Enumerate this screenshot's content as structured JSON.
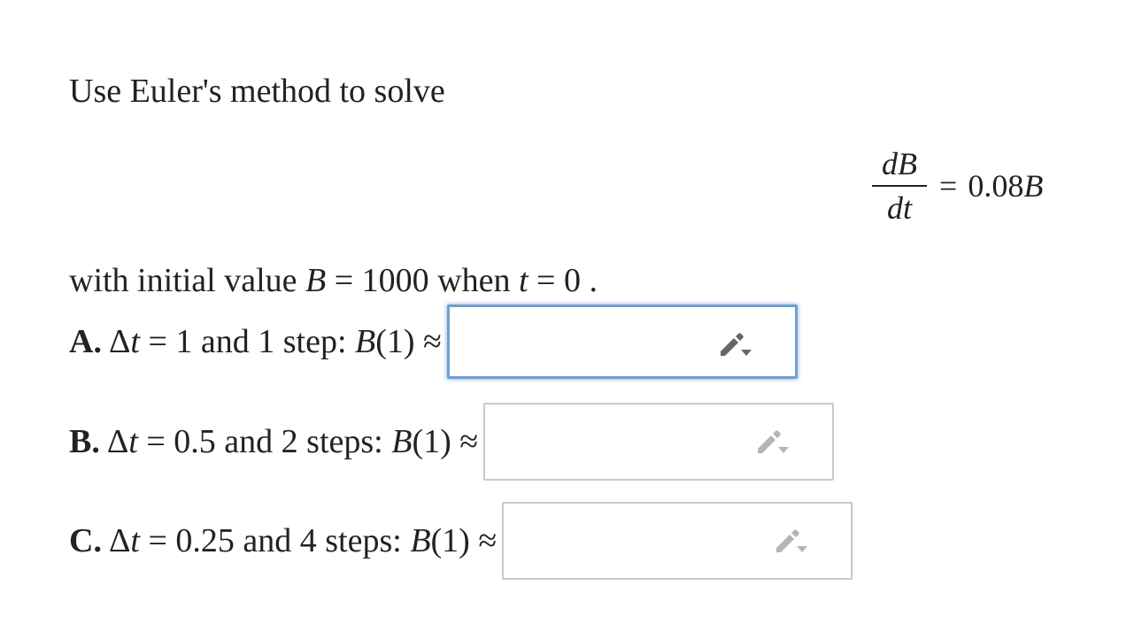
{
  "problem": {
    "intro": "Use Euler's method to solve",
    "equation": {
      "numerator": "dB",
      "denominator": "dt",
      "equals": "=",
      "rhs_number": "0.08",
      "rhs_variable": "B"
    },
    "initial": {
      "prefix": "with initial value ",
      "var_b": "B",
      "eq1": " = 1000 when ",
      "var_t": "t",
      "eq2": " = 0 ."
    }
  },
  "questions": [
    {
      "label": "A.",
      "delta": "Δ",
      "var_t": "t",
      "text": " = 1 and 1 step: ",
      "result_var": "B",
      "result_arg": "(1) ≈",
      "answer_value": "",
      "focused": true,
      "icon_color": "#666666"
    },
    {
      "label": "B.",
      "delta": "Δ",
      "var_t": "t",
      "text": " = 0.5 and 2 steps: ",
      "result_var": "B",
      "result_arg": "(1) ≈",
      "answer_value": "",
      "focused": false,
      "icon_color": "#b5b5b5"
    },
    {
      "label": "C.",
      "delta": "Δ",
      "var_t": "t",
      "text": " = 0.25 and 4 steps: ",
      "result_var": "B",
      "result_arg": "(1) ≈",
      "answer_value": "",
      "focused": false,
      "icon_color": "#b5b5b5"
    }
  ],
  "colors": {
    "focus_border": "#6ea0d2",
    "box_border": "#c8c8c8",
    "text": "#222222"
  }
}
